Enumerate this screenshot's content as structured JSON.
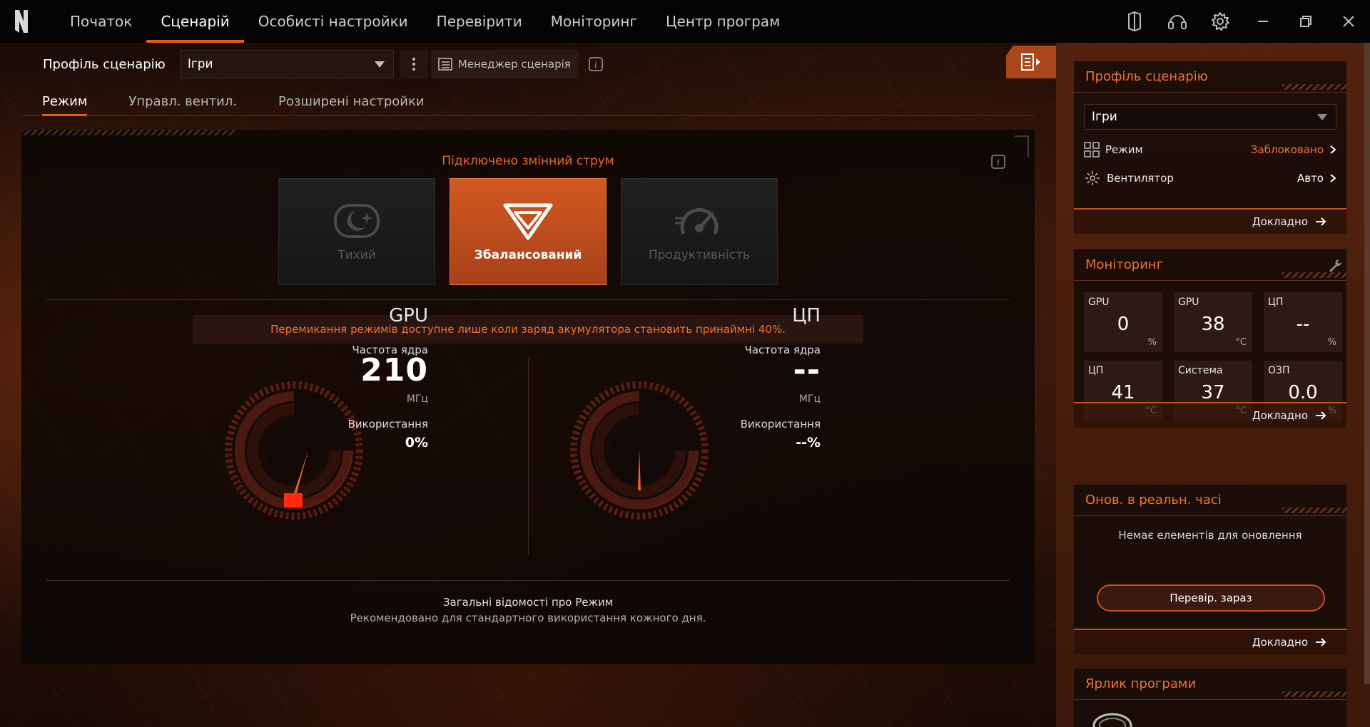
{
  "app": {
    "nav": [
      "Початок",
      "Сценарій",
      "Особисті настройки",
      "Перевірити",
      "Моніторинг",
      "Центр програм"
    ],
    "active_nav_index": 1,
    "accent_color": "#e55a1f"
  },
  "profile": {
    "label": "Профіль сценарію",
    "selected": "Ігри",
    "manager_label": "Менеджер сценарія"
  },
  "subtabs": [
    "Режим",
    "Управл. вентил.",
    "Розширені настройки"
  ],
  "mode_panel": {
    "power_status": "Підключено змінний струм",
    "modes": [
      "Тихий",
      "Збалансований",
      "Продуктивність"
    ],
    "active_mode_index": 1,
    "warning": "Перемикання режимів доступне лише коли заряд акумулятора становить принаймні 40%.",
    "gpu": {
      "title": "GPU",
      "freq_label": "Частота ядра",
      "freq_value": "210",
      "unit": "МГц",
      "usage_label": "Використання",
      "usage_value": "0%"
    },
    "cpu": {
      "title": "ЦП",
      "freq_label": "Частота ядра",
      "freq_value": "--",
      "unit": "МГц",
      "usage_label": "Використання",
      "usage_value": "--%"
    },
    "about_title": "Загальні відомості про Режим",
    "about_desc": "Рекомендовано для стандартного використання кожного дня."
  },
  "sidebar": {
    "profile_card": {
      "title": "Профіль сценарію",
      "selected": "Ігри",
      "mode_label": "Режим",
      "mode_value": "Заблоковано",
      "fan_label": "Вентилятор",
      "fan_value": "Авто",
      "more": "Докладно",
      "locked_color": "#f07238"
    },
    "monitor_card": {
      "title": "Моніторинг",
      "tiles": [
        {
          "label": "GPU",
          "value": "0",
          "unit": "%"
        },
        {
          "label": "GPU",
          "value": "38",
          "unit": "°C"
        },
        {
          "label": "ЦП",
          "value": "--",
          "unit": "%"
        },
        {
          "label": "ЦП",
          "value": "41",
          "unit": "°C"
        },
        {
          "label": "Система",
          "value": "37",
          "unit": "°C"
        },
        {
          "label": "ОЗП",
          "value": "0.0",
          "unit": "%"
        }
      ],
      "more": "Докладно"
    },
    "realtime_card": {
      "title": "Онов. в реальн. часі",
      "empty": "Немає елементів для оновлення",
      "button": "Перевір. зараз",
      "more": "Докладно"
    },
    "shortcut_card": {
      "title": "Ярлик програми"
    }
  }
}
